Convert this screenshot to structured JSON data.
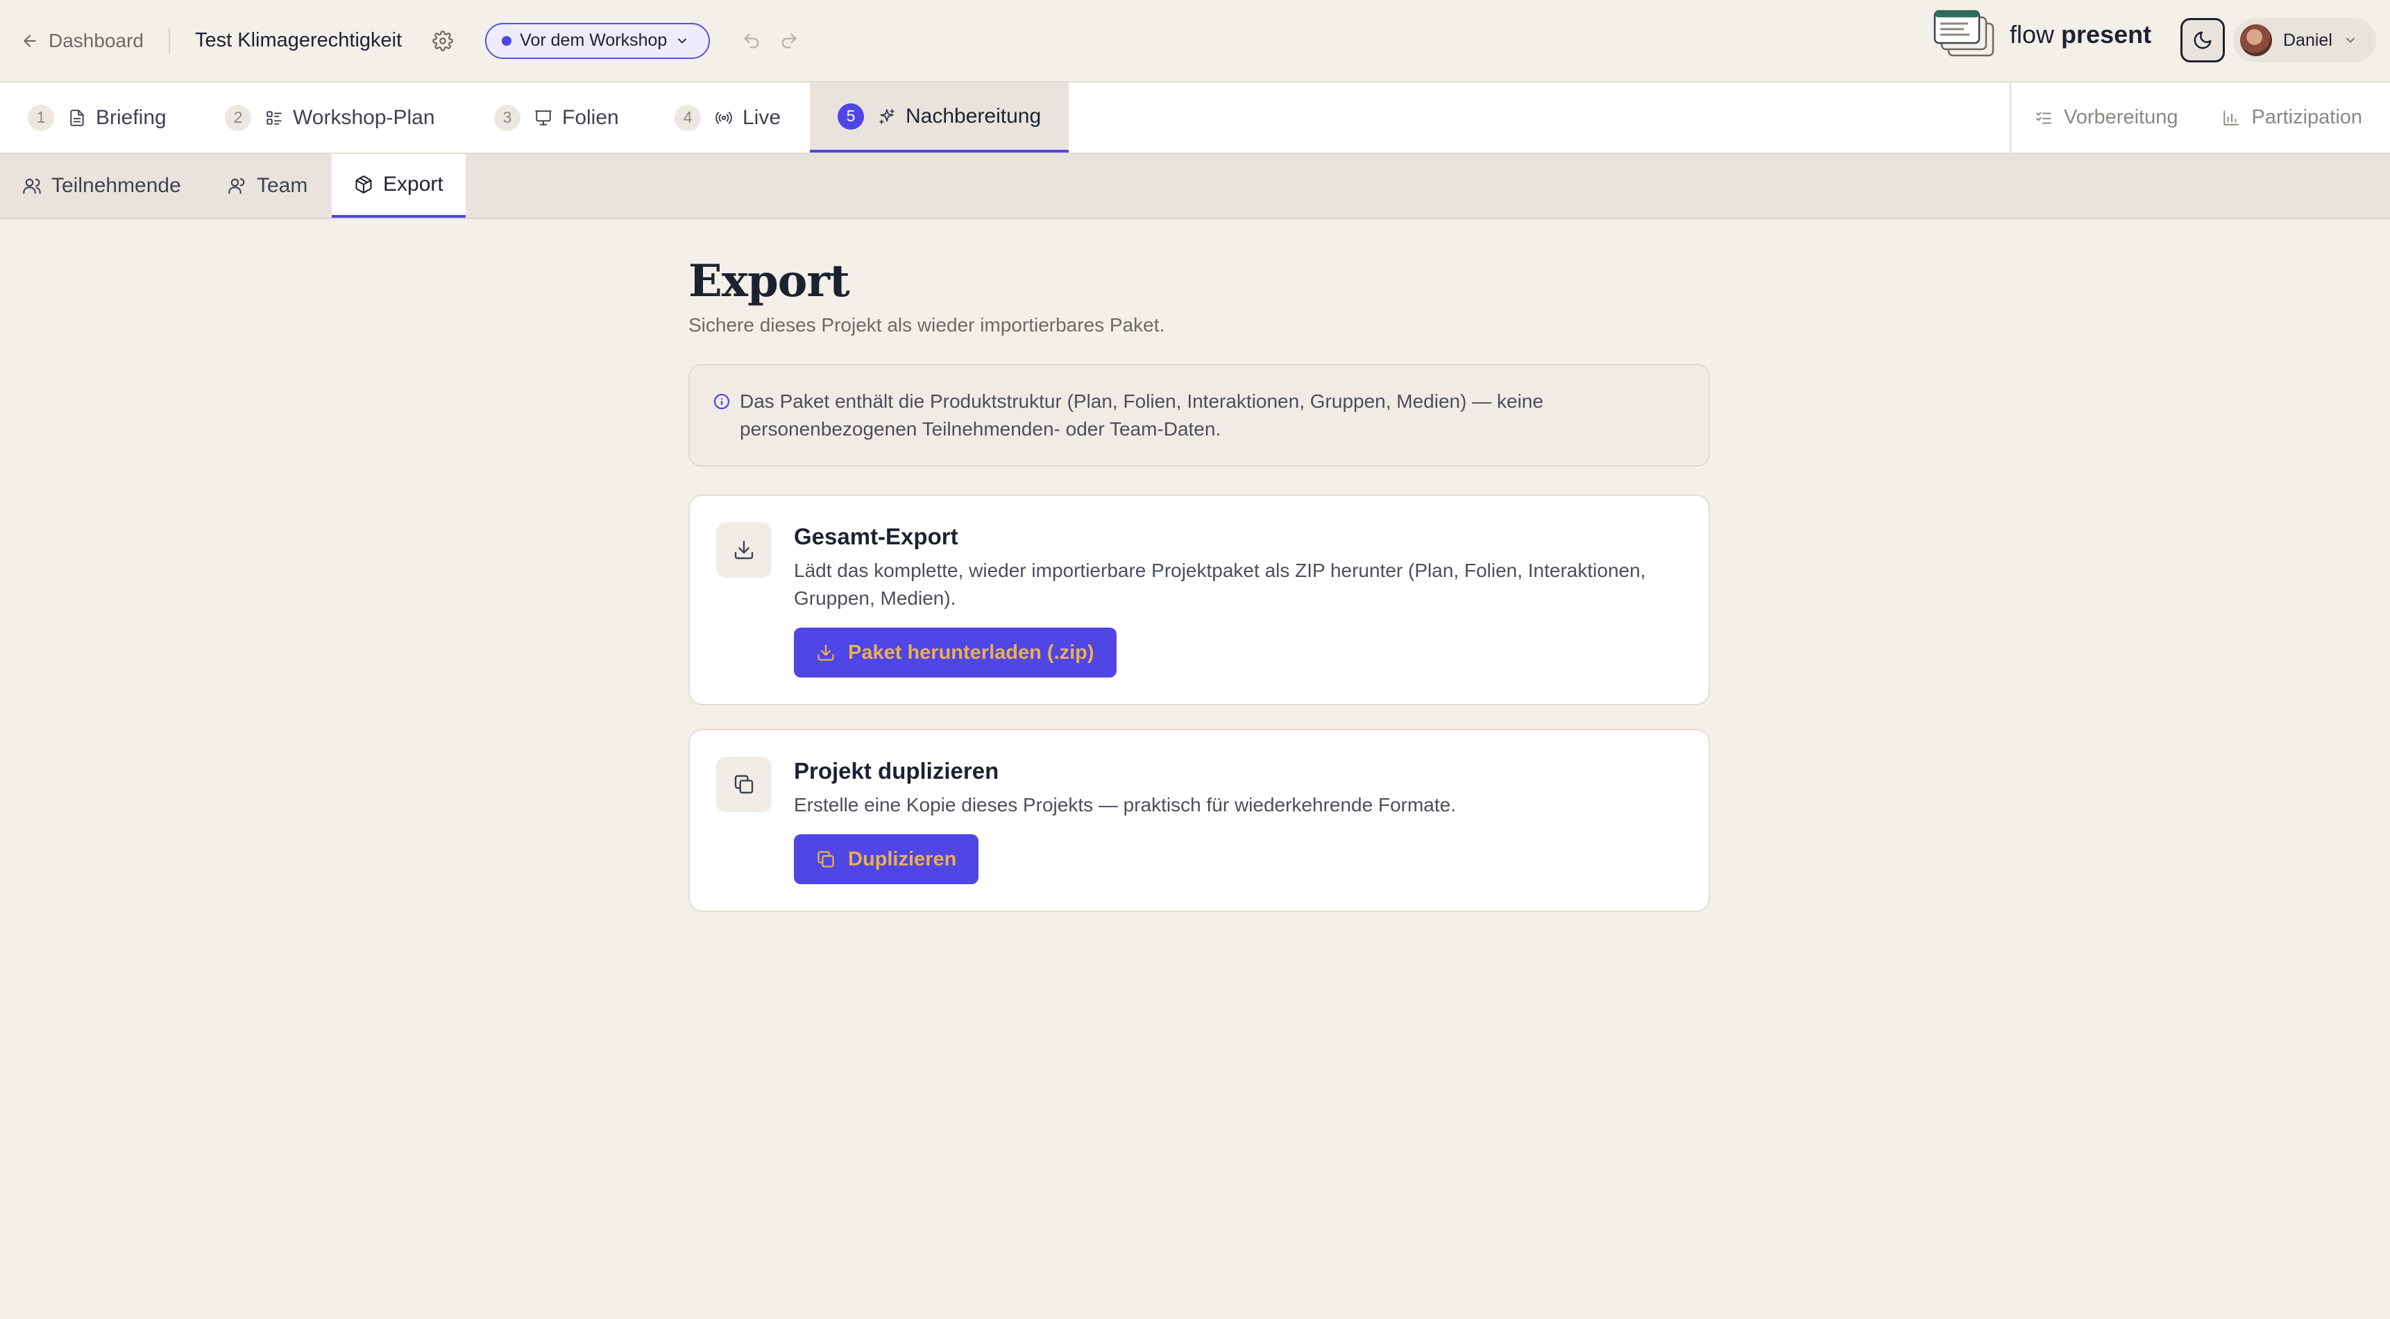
{
  "topbar": {
    "back_label": "Dashboard",
    "project_title": "Test Klimagerechtigkeit",
    "status_label": "Vor dem Workshop",
    "brand_light": "flow",
    "brand_bold": "present",
    "user_name": "Daniel"
  },
  "steps": [
    {
      "num": "1",
      "label": "Briefing",
      "icon": "document-icon"
    },
    {
      "num": "2",
      "label": "Workshop-Plan",
      "icon": "plan-list-icon"
    },
    {
      "num": "3",
      "label": "Folien",
      "icon": "presentation-icon"
    },
    {
      "num": "4",
      "label": "Live",
      "icon": "broadcast-icon"
    },
    {
      "num": "5",
      "label": "Nachbereitung",
      "icon": "sparkle-icon",
      "active": true
    }
  ],
  "modes": {
    "preparation": "Vorbereitung",
    "participation": "Partizipation"
  },
  "subtabs": [
    {
      "label": "Teilnehmende",
      "icon": "users-icon"
    },
    {
      "label": "Team",
      "icon": "team-icon"
    },
    {
      "label": "Export",
      "icon": "package-icon",
      "active": true
    }
  ],
  "main": {
    "title": "Export",
    "subtitle": "Sichere dieses Projekt als wieder importierbares Paket.",
    "info": "Das Paket enthält die Produktstruktur (Plan, Folien, Interaktionen, Gruppen, Medien) — keine personenbezogenen Teilnehmenden- oder Team-Daten.",
    "cards": [
      {
        "title": "Gesamt-Export",
        "description": "Lädt das komplette, wieder importierbare Projektpaket als ZIP herunter (Plan, Folien, Interaktionen, Gruppen, Medien).",
        "button": "Paket herunterladen (.zip)",
        "icon": "download-icon"
      },
      {
        "title": "Projekt duplizieren",
        "description": "Erstelle eine Kopie dieses Projekts — praktisch für wiederkehrende Formate.",
        "button": "Duplizieren",
        "icon": "copy-icon"
      }
    ]
  },
  "colors": {
    "accent": "#4f46e5",
    "button_text": "#e9b04d",
    "background": "#f3efe9"
  }
}
